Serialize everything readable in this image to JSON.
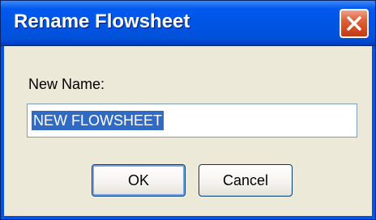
{
  "dialog": {
    "title": "Rename Flowsheet",
    "label": "New Name:",
    "name_value": "NEW FLOWSHEET",
    "ok_label": "OK",
    "cancel_label": "Cancel"
  },
  "icons": {
    "close": "close-icon"
  },
  "colors": {
    "titlebar": "#0054e3",
    "close_button": "#d24d22",
    "selection": "#316ac5",
    "dialog_bg": "#ece9d8"
  }
}
